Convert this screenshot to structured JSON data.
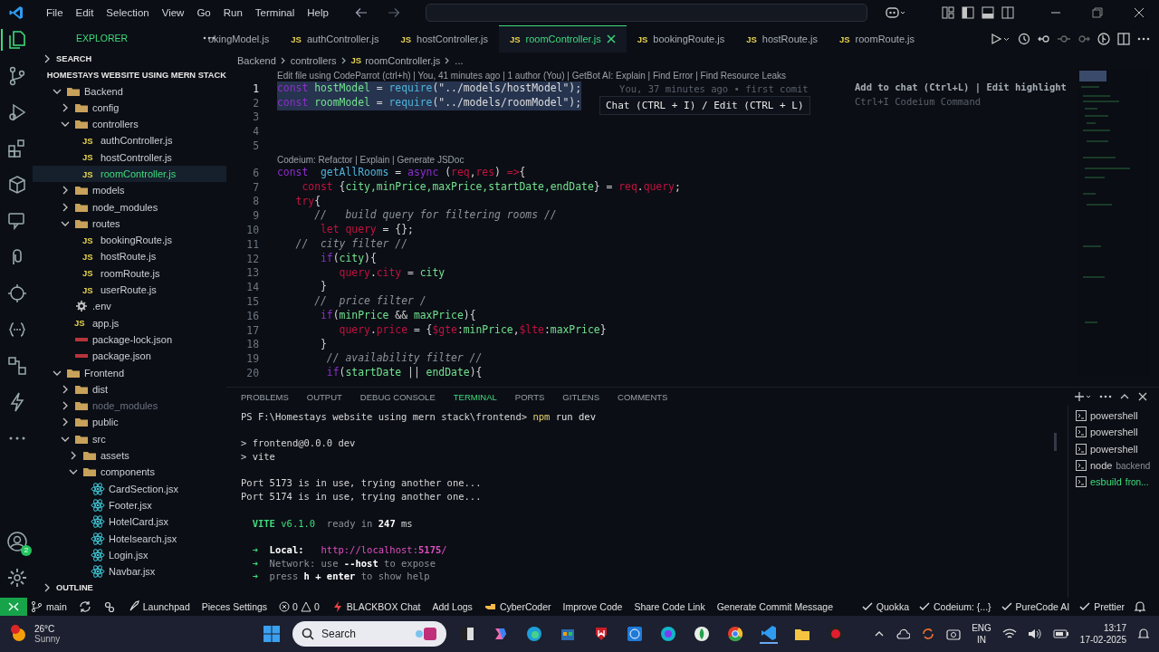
{
  "menu": [
    "File",
    "Edit",
    "Selection",
    "View",
    "Go",
    "Run",
    "Terminal",
    "Help"
  ],
  "activity_bar": {
    "account_badge": "2"
  },
  "sidebar": {
    "title": "EXPLORER",
    "sections": [
      {
        "label": "SEARCH",
        "expanded": false
      },
      {
        "label": "HOMESTAYS WEBSITE USING MERN STACK",
        "expanded": true
      }
    ],
    "tree": [
      {
        "label": "Backend",
        "kind": "folder",
        "expanded": true,
        "selected": false,
        "children": [
          {
            "label": "config",
            "kind": "folder",
            "expanded": false,
            "selected": false
          },
          {
            "label": "controllers",
            "kind": "folder",
            "expanded": true,
            "selected": false,
            "children": [
              {
                "label": "authController.js",
                "kind": "js",
                "badge": "JS",
                "selected": false
              },
              {
                "label": "hostController.js",
                "kind": "js",
                "badge": "JS",
                "selected": false
              },
              {
                "label": "roomController.js",
                "kind": "js",
                "badge": "JS",
                "selected": true
              }
            ]
          },
          {
            "label": "models",
            "kind": "folder",
            "expanded": false,
            "selected": false
          },
          {
            "label": "node_modules",
            "kind": "folder",
            "expanded": false,
            "selected": false
          },
          {
            "label": "routes",
            "kind": "folder",
            "expanded": true,
            "selected": false,
            "children": [
              {
                "label": "bookingRoute.js",
                "kind": "js",
                "badge": "JS",
                "selected": false
              },
              {
                "label": "hostRoute.js",
                "kind": "js",
                "badge": "JS",
                "selected": false
              },
              {
                "label": "roomRoute.js",
                "kind": "js",
                "badge": "JS",
                "selected": false
              },
              {
                "label": "userRoute.js",
                "kind": "js",
                "badge": "JS",
                "selected": false
              }
            ]
          },
          {
            "label": ".env",
            "kind": "env",
            "selected": false
          },
          {
            "label": "app.js",
            "kind": "js",
            "badge": "JS",
            "selected": false
          },
          {
            "label": "package-lock.json",
            "kind": "json",
            "selected": false
          },
          {
            "label": "package.json",
            "kind": "json",
            "selected": false
          }
        ]
      },
      {
        "label": "Frontend",
        "kind": "folder",
        "expanded": true,
        "selected": false,
        "children": [
          {
            "label": "dist",
            "kind": "folder",
            "expanded": false,
            "selected": false
          },
          {
            "label": "node_modules",
            "kind": "folder",
            "expanded": false,
            "selected": false,
            "ignored": true
          },
          {
            "label": "public",
            "kind": "folder",
            "expanded": false,
            "selected": false
          },
          {
            "label": "src",
            "kind": "folder",
            "expanded": true,
            "selected": false,
            "children": [
              {
                "label": "assets",
                "kind": "folder",
                "expanded": false,
                "selected": false
              },
              {
                "label": "components",
                "kind": "folder",
                "expanded": true,
                "selected": false,
                "children": [
                  {
                    "label": "CardSection.jsx",
                    "kind": "jsx",
                    "selected": false
                  },
                  {
                    "label": "Footer.jsx",
                    "kind": "jsx",
                    "selected": false
                  },
                  {
                    "label": "HotelCard.jsx",
                    "kind": "jsx",
                    "selected": false
                  },
                  {
                    "label": "Hotelsearch.jsx",
                    "kind": "jsx",
                    "selected": false
                  },
                  {
                    "label": "Login.jsx",
                    "kind": "jsx",
                    "selected": false
                  },
                  {
                    "label": "Navbar.jsx",
                    "kind": "jsx",
                    "selected": false
                  }
                ]
              }
            ]
          }
        ]
      }
    ],
    "outline": {
      "label": "OUTLINE",
      "expanded": false
    }
  },
  "tabs": [
    {
      "label": "okingModel.js",
      "selected": false
    },
    {
      "label": "authController.js",
      "badge": "JS",
      "selected": false
    },
    {
      "label": "hostController.js",
      "badge": "JS",
      "selected": false
    },
    {
      "label": "roomController.js",
      "badge": "JS",
      "selected": true
    },
    {
      "label": "bookingRoute.js",
      "badge": "JS",
      "selected": false
    },
    {
      "label": "hostRoute.js",
      "badge": "JS",
      "selected": false
    },
    {
      "label": "roomRoute.js",
      "badge": "JS",
      "selected": false
    }
  ],
  "breadcrumbs": [
    {
      "label": "Backend"
    },
    {
      "label": "controllers"
    },
    {
      "label": "roomController.js",
      "badge": "JS"
    },
    {
      "label": "..."
    }
  ],
  "editor": {
    "codelens": "Edit file using CodeParrot (ctrl+h) | You, 41 minutes ago | 1 author (You) | GetBot AI: Explain | Find Error | Find Resource Leaks",
    "blame": "You, 37 minutes ago • first comit",
    "hover": "Chat (CTRL + I) / Edit (CTRL + L)",
    "hints": [
      "Add to chat (Ctrl+L) | Edit highlight",
      "Ctrl+I Codeium Command"
    ],
    "lines": [
      {
        "num": "1",
        "selected": true,
        "tokens": [
          {
            "t": "const",
            "kind": "kw"
          },
          {
            "t": " hostModel",
            "kind": "id"
          },
          {
            "t": " = ",
            "kind": "p"
          },
          {
            "t": "require",
            "kind": "fn"
          },
          {
            "t": "(\"../models/hostModel\");",
            "kind": "str"
          }
        ]
      },
      {
        "num": "2",
        "selected": true,
        "tokens": [
          {
            "t": "const",
            "kind": "kw"
          },
          {
            "t": " roomModel",
            "kind": "id"
          },
          {
            "t": " = ",
            "kind": "p"
          },
          {
            "t": "require",
            "kind": "fn"
          },
          {
            "t": "(\"../models/roomModel\");",
            "kind": "str"
          }
        ]
      },
      {
        "num": "3"
      },
      {
        "num": "4"
      },
      {
        "num": "5"
      },
      {
        "num": "6",
        "selected": false,
        "codelens": "Codeium: Refactor | Explain | Generate JSDoc",
        "tokens": [
          {
            "t": "const",
            "kind": "kw"
          },
          {
            "t": "  getAllRooms",
            "kind": "fn"
          },
          {
            "t": " = ",
            "kind": "p"
          },
          {
            "t": "async",
            "kind": "kw"
          },
          {
            "t": " (",
            "kind": "p"
          },
          {
            "t": "req",
            "kind": "red"
          },
          {
            "t": ",",
            "kind": "p"
          },
          {
            "t": "res",
            "kind": "red"
          },
          {
            "t": ") ",
            "kind": "p"
          },
          {
            "t": "=>",
            "kind": "red"
          },
          {
            "t": "{",
            "kind": "p"
          }
        ]
      },
      {
        "num": "7",
        "selected": false,
        "tokens": [
          {
            "t": "    const",
            "kind": "red"
          },
          {
            "t": " {",
            "kind": "p"
          },
          {
            "t": "city,minPrice,maxPrice,startDate,endDate",
            "kind": "id"
          },
          {
            "t": "} = ",
            "kind": "p"
          },
          {
            "t": "req",
            "kind": "red"
          },
          {
            "t": ".",
            "kind": "p"
          },
          {
            "t": "query",
            "kind": "red"
          },
          {
            "t": ";",
            "kind": "p"
          }
        ]
      },
      {
        "num": "8",
        "selected": false,
        "tokens": [
          {
            "t": "   try",
            "kind": "red"
          },
          {
            "t": "{",
            "kind": "p"
          }
        ]
      },
      {
        "num": "9",
        "selected": false,
        "tokens": [
          {
            "t": "      //   build query for filtering rooms //",
            "kind": "com"
          }
        ]
      },
      {
        "num": "10",
        "selected": false,
        "tokens": [
          {
            "t": "       let",
            "kind": "red"
          },
          {
            "t": " query",
            "kind": "red"
          },
          {
            "t": " = {};",
            "kind": "p"
          }
        ]
      },
      {
        "num": "11",
        "selected": false,
        "tokens": [
          {
            "t": "   //  city filter //",
            "kind": "com"
          }
        ]
      },
      {
        "num": "12",
        "selected": false,
        "tokens": [
          {
            "t": "       if",
            "kind": "kw"
          },
          {
            "t": "(",
            "kind": "p"
          },
          {
            "t": "city",
            "kind": "id"
          },
          {
            "t": "){",
            "kind": "p"
          }
        ]
      },
      {
        "num": "13",
        "selected": false,
        "tokens": [
          {
            "t": "          query",
            "kind": "red"
          },
          {
            "t": ".",
            "kind": "p"
          },
          {
            "t": "city",
            "kind": "red"
          },
          {
            "t": " = ",
            "kind": "p"
          },
          {
            "t": "city",
            "kind": "id"
          }
        ]
      },
      {
        "num": "14",
        "selected": false,
        "tokens": [
          {
            "t": "       }",
            "kind": "p"
          }
        ]
      },
      {
        "num": "15",
        "selected": false,
        "tokens": [
          {
            "t": "      //  price filter /",
            "kind": "com"
          }
        ]
      },
      {
        "num": "16",
        "selected": false,
        "tokens": [
          {
            "t": "       if",
            "kind": "kw"
          },
          {
            "t": "(",
            "kind": "p"
          },
          {
            "t": "minPrice",
            "kind": "id"
          },
          {
            "t": " && ",
            "kind": "p"
          },
          {
            "t": "maxPrice",
            "kind": "id"
          },
          {
            "t": "){",
            "kind": "p"
          }
        ]
      },
      {
        "num": "17",
        "selected": false,
        "tokens": [
          {
            "t": "          query",
            "kind": "red"
          },
          {
            "t": ".",
            "kind": "p"
          },
          {
            "t": "price",
            "kind": "red"
          },
          {
            "t": " = {",
            "kind": "p"
          },
          {
            "t": "$gte",
            "kind": "red"
          },
          {
            "t": ":",
            "kind": "p"
          },
          {
            "t": "minPrice",
            "kind": "id"
          },
          {
            "t": ",",
            "kind": "p"
          },
          {
            "t": "$lte",
            "kind": "red"
          },
          {
            "t": ":",
            "kind": "p"
          },
          {
            "t": "maxPrice",
            "kind": "id"
          },
          {
            "t": "}",
            "kind": "p"
          }
        ]
      },
      {
        "num": "18",
        "selected": false,
        "tokens": [
          {
            "t": "       }",
            "kind": "p"
          }
        ]
      },
      {
        "num": "19",
        "selected": false,
        "tokens": [
          {
            "t": "        // availability filter //",
            "kind": "com"
          }
        ]
      },
      {
        "num": "20",
        "selected": false,
        "tokens": [
          {
            "t": "        if",
            "kind": "kw"
          },
          {
            "t": "(",
            "kind": "p"
          },
          {
            "t": "startDate",
            "kind": "id"
          },
          {
            "t": " || ",
            "kind": "p"
          },
          {
            "t": "endDate",
            "kind": "id"
          },
          {
            "t": "){",
            "kind": "p"
          }
        ]
      }
    ]
  },
  "panel": {
    "tabs": [
      {
        "label": "PROBLEMS",
        "selected": false
      },
      {
        "label": "OUTPUT",
        "selected": false
      },
      {
        "label": "DEBUG CONSOLE",
        "selected": false
      },
      {
        "label": "TERMINAL",
        "selected": true
      },
      {
        "label": "PORTS",
        "selected": false
      },
      {
        "label": "GITLENS",
        "selected": false
      },
      {
        "label": "COMMENTS",
        "selected": false
      }
    ],
    "terminal": [
      {
        "segs": [
          {
            "t": "PS F:\\Homestays website using mern stack\\frontend> ",
            "kind": "p"
          },
          {
            "t": "npm",
            "kind": "cmd"
          },
          {
            "t": " run dev",
            "kind": "arg"
          }
        ]
      },
      {
        "space_before": true,
        "segs": [
          {
            "t": "> frontend@0.0.0 dev",
            "kind": "p"
          }
        ]
      },
      {
        "segs": [
          {
            "t": "> vite",
            "kind": "p"
          }
        ]
      },
      {
        "space_before": true,
        "segs": [
          {
            "t": "Port 5173 is in use, trying another one...",
            "kind": "p"
          }
        ]
      },
      {
        "segs": [
          {
            "t": "Port 5174 is in use, trying another one...",
            "kind": "p"
          }
        ]
      },
      {
        "space_before": true,
        "segs": [
          {
            "t": "  VITE",
            "kind": "vite"
          },
          {
            "t": " v6.1.0",
            "kind": "green"
          },
          {
            "t": "  ready in ",
            "kind": "dim"
          },
          {
            "t": "247",
            "kind": "bold"
          },
          {
            "t": " ms",
            "kind": "p"
          }
        ]
      },
      {
        "space_before": true,
        "segs": [
          {
            "t": "  ➜  ",
            "kind": "green"
          },
          {
            "t": "Local",
            "kind": "bold"
          },
          {
            "t": ":   ",
            "kind": "bold"
          },
          {
            "t": "http://localhost:",
            "kind": "link"
          },
          {
            "t": "5175",
            "kind": "linkbold"
          },
          {
            "t": "/",
            "kind": "link"
          }
        ]
      },
      {
        "segs": [
          {
            "t": "  ➜  ",
            "kind": "green"
          },
          {
            "t": "Network",
            "kind": "dim"
          },
          {
            "t": ": use ",
            "kind": "dim"
          },
          {
            "t": "--host",
            "kind": "bold"
          },
          {
            "t": " to expose",
            "kind": "dim"
          }
        ]
      },
      {
        "segs": [
          {
            "t": "  ➜  ",
            "kind": "green"
          },
          {
            "t": "press ",
            "kind": "dim"
          },
          {
            "t": "h + enter",
            "kind": "bold"
          },
          {
            "t": " to show help",
            "kind": "dim"
          }
        ]
      }
    ],
    "sessions": [
      {
        "name": "powershell",
        "selected": false
      },
      {
        "name": "powershell",
        "selected": false
      },
      {
        "name": "powershell",
        "selected": false
      },
      {
        "name": "node",
        "detail": "backend",
        "selected": false
      },
      {
        "name": "esbuild",
        "detail": "fron...",
        "selected": true
      }
    ]
  },
  "status_bar": {
    "left": [
      {
        "kind": "branch",
        "label": "main"
      },
      {
        "kind": "sync"
      },
      {
        "kind": "plugin"
      },
      {
        "kind": "rocket",
        "label": "Launchpad"
      },
      {
        "kind": "text",
        "label": "Pieces Settings"
      },
      {
        "kind": "problems",
        "errors": "0",
        "warnings": "0"
      },
      {
        "kind": "bolt",
        "label": "BLACKBOX Chat"
      },
      {
        "kind": "text",
        "label": "Add Logs"
      },
      {
        "kind": "hand",
        "label": "CyberCoder"
      },
      {
        "kind": "text",
        "label": "Improve Code"
      },
      {
        "kind": "text",
        "label": "Share Code Link"
      },
      {
        "kind": "text",
        "label": "Generate Commit Message"
      }
    ],
    "right": [
      {
        "kind": "check",
        "label": "Quokka"
      },
      {
        "kind": "check",
        "label": "Codeium: {...}"
      },
      {
        "kind": "check",
        "label": "PureCode AI"
      },
      {
        "kind": "check",
        "label": "Prettier"
      },
      {
        "kind": "bell"
      }
    ]
  },
  "taskbar": {
    "temperature": "26°C",
    "condition": "Sunny",
    "search": "Search",
    "language": "ENG",
    "region": "IN",
    "time": "13:17",
    "date": "17-02-2025"
  }
}
